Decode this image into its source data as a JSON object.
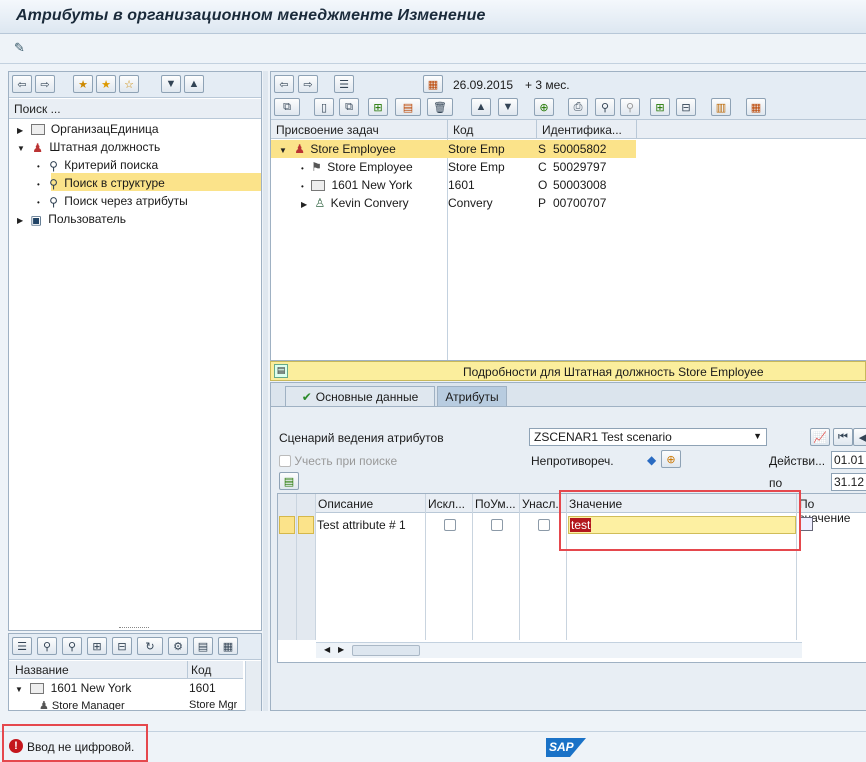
{
  "window": {
    "title": "Атрибуты в организационном менеджменте Изменение"
  },
  "left_panel": {
    "search_label": "Поиск ...",
    "tree": [
      {
        "label": "ОрганизацЕдиница"
      },
      {
        "label": "Штатная должность"
      },
      {
        "label": "Критерий поиска"
      },
      {
        "label": "Поиск в структуре"
      },
      {
        "label": "Поиск через атрибуты"
      },
      {
        "label": "Пользователь"
      }
    ]
  },
  "bottom_left": {
    "col_name": "Название",
    "col_code": "Код",
    "rows": [
      {
        "name": "1601 New York",
        "code": "1601"
      },
      {
        "name": "Store Manager",
        "code": "Store Mgr"
      }
    ]
  },
  "right_panel": {
    "date": "26.09.2015",
    "date_suffix": "+ 3 мес.",
    "columns": {
      "assignment": "Присвоение задач",
      "code": "Код",
      "id": "Идентифика..."
    },
    "rows": [
      {
        "name": "Store Employee",
        "code": "Store Emp",
        "type": "S",
        "id": "50005802"
      },
      {
        "name": "Store Employee",
        "code": "Store Emp",
        "type": "C",
        "id": "50029797"
      },
      {
        "name": "1601 New York",
        "code": "1601",
        "type": "O",
        "id": "50003008"
      },
      {
        "name": "Kevin Convery",
        "code": "Convery",
        "type": "P",
        "id": "00700707"
      }
    ],
    "details_title": "Подробности для Штатная должность Store Employee",
    "tabs": {
      "basic": "Основные данные",
      "attributes": "Атрибуты"
    }
  },
  "attributes": {
    "scenario_label": "Сценарий ведения атрибутов",
    "scenario_value": "ZSCENAR1 Test scenario",
    "consider_label": "Учесть при поиске",
    "consistency_label": "Непротивореч.",
    "valid_label": "Действи...",
    "valid_from": "01.01",
    "to_label": "по",
    "valid_to": "31.12",
    "grid": {
      "columns": {
        "description": "Описание",
        "excl": "Искл...",
        "by_default": "ПоУм...",
        "inherit": "Унасл.",
        "value": "Значение",
        "by_value": "По значение"
      },
      "rows": [
        {
          "description": "Test attribute # 1",
          "value": "test"
        }
      ]
    }
  },
  "status": {
    "message": "Ввод не цифровой.",
    "logo": "SAP"
  }
}
